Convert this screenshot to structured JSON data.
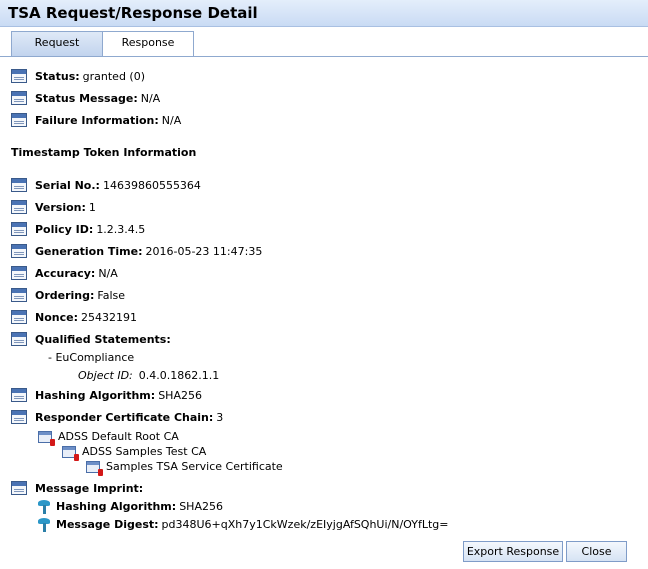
{
  "window": {
    "title": "TSA Request/Response Detail"
  },
  "tabs": [
    {
      "label": "Request"
    },
    {
      "label": "Response"
    }
  ],
  "response": {
    "status": {
      "label": "Status:",
      "value": "granted (0)"
    },
    "status_message": {
      "label": "Status Message:",
      "value": "N/A"
    },
    "failure_information": {
      "label": "Failure Information:",
      "value": "N/A"
    }
  },
  "token": {
    "heading": "Timestamp Token Information",
    "serial_no": {
      "label": "Serial No.:",
      "value": "14639860555364"
    },
    "version": {
      "label": "Version:",
      "value": "1"
    },
    "policy_id": {
      "label": "Policy ID:",
      "value": "1.2.3.4.5"
    },
    "generation_time": {
      "label": "Generation Time:",
      "value": "2016-05-23 11:47:35"
    },
    "accuracy": {
      "label": "Accuracy:",
      "value": "N/A"
    },
    "ordering": {
      "label": "Ordering:",
      "value": "False"
    },
    "nonce": {
      "label": "Nonce:",
      "value": "25432191"
    },
    "qualified_statements": {
      "label": "Qualified Statements:",
      "statement": "- EuCompliance",
      "object_id_label": "Object ID:",
      "object_id_value": "0.4.0.1862.1.1"
    },
    "hashing_algorithm": {
      "label": "Hashing Algorithm:",
      "value": "SHA256"
    },
    "responder_chain": {
      "label": "Responder Certificate Chain:",
      "value": "3",
      "certs": [
        "ADSS Default Root CA",
        "ADSS Samples Test CA",
        "Samples TSA Service Certificate"
      ]
    },
    "message_imprint": {
      "label": "Message Imprint:",
      "hashing_algorithm": {
        "label": "Hashing Algorithm:",
        "value": "SHA256"
      },
      "message_digest": {
        "label": "Message Digest:",
        "value": "pd348U6+qXh7y1CkWzek/zEIyjgAfSQhUi/N/OYfLtg="
      }
    }
  },
  "buttons": {
    "export": "Export Response",
    "close": "Close"
  }
}
